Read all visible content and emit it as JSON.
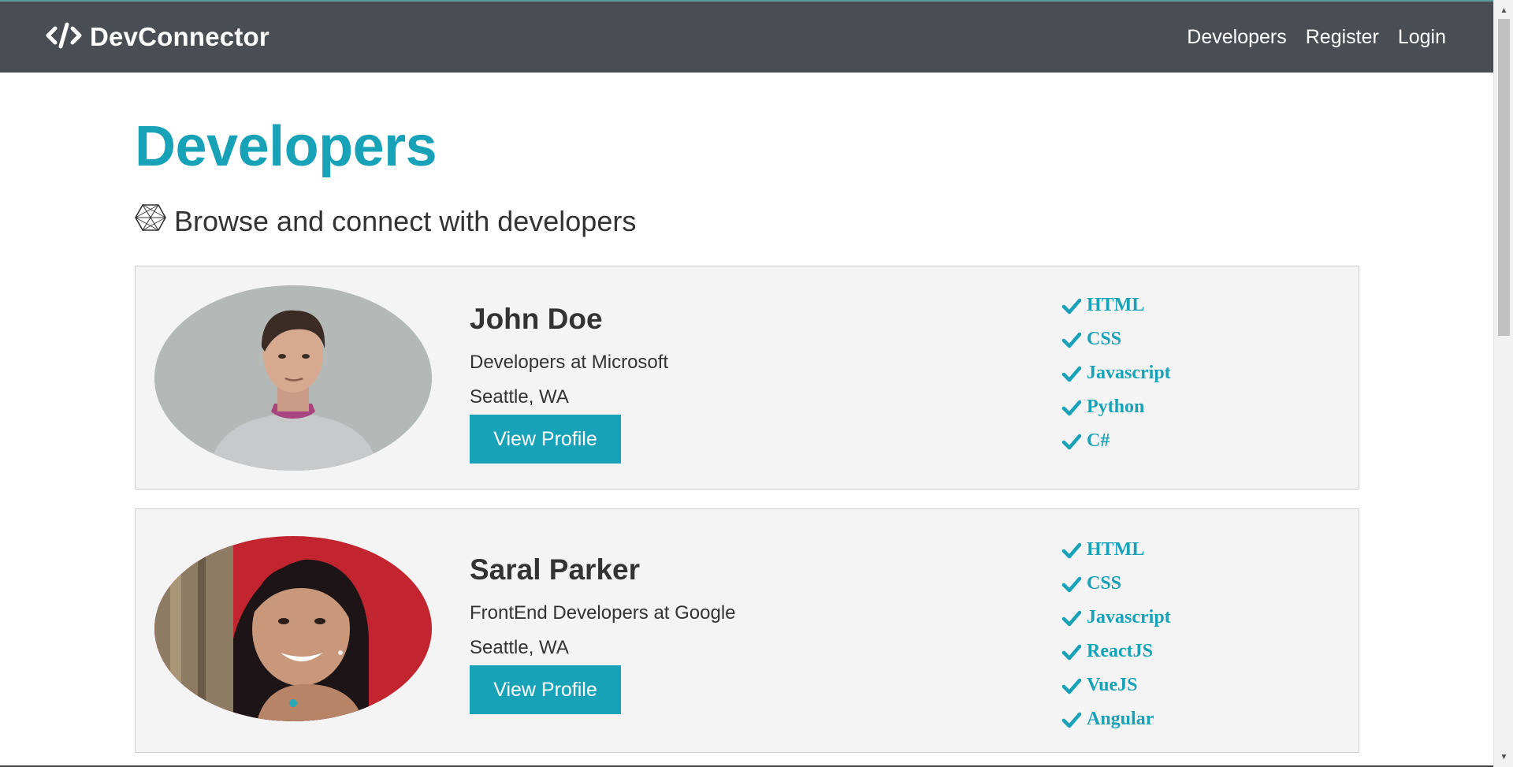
{
  "navbar": {
    "brand": "DevConnector",
    "links": [
      "Developers",
      "Register",
      "Login"
    ]
  },
  "page": {
    "title": "Developers",
    "lead": "Browse and connect with developers"
  },
  "profiles": [
    {
      "name": "John Doe",
      "status": "Developers at Microsoft",
      "location": "Seattle, WA",
      "button": "View Profile",
      "skills": [
        "HTML",
        "CSS",
        "Javascript",
        "Python",
        "C#"
      ]
    },
    {
      "name": "Saral Parker",
      "status": "FrontEnd Developers at Google",
      "location": "Seattle, WA",
      "button": "View Profile",
      "skills": [
        "HTML",
        "CSS",
        "Javascript",
        "ReactJS",
        "VueJS",
        "Angular"
      ]
    }
  ],
  "colors": {
    "accent": "#17a2b8",
    "navbar": "#484e54",
    "card_bg": "#f4f4f4"
  },
  "icons": {
    "brand": "code-icon",
    "lead": "connectdevelop-icon",
    "skill": "check-icon"
  }
}
